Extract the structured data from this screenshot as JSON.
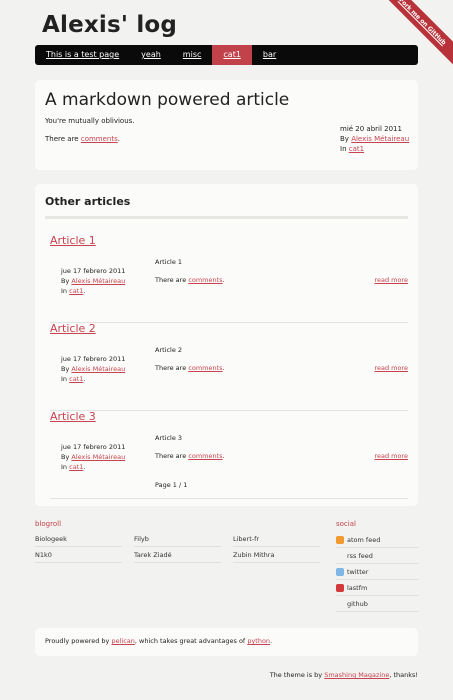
{
  "ribbon": {
    "label": "Fork me on GitHub"
  },
  "site": {
    "title": "Alexis' log"
  },
  "nav": [
    {
      "label": "This is a test page",
      "active": false
    },
    {
      "label": "yeah",
      "active": false
    },
    {
      "label": "misc",
      "active": false
    },
    {
      "label": "cat1",
      "active": true
    },
    {
      "label": "bar",
      "active": false
    }
  ],
  "featured": {
    "title": "A markdown powered article",
    "summary": "You're mutually oblivious.",
    "comments_prefix": "There are",
    "comments_link": "comments",
    "comments_suffix": ".",
    "date": "mié 20 abril 2011",
    "by": "By",
    "author": "Alexis Métaireau",
    "in": "In",
    "category": "cat1"
  },
  "others": {
    "heading": "Other articles",
    "articles": [
      {
        "title": "Article 1",
        "date": "jue 17 febrero 2011",
        "by": "By",
        "author": "Alexis Métaireau",
        "in": "In",
        "category": "cat1",
        "body": "Article 1",
        "comments_prefix": "There are",
        "comments_link": "comments",
        "comments_suffix": ".",
        "read_more": "read more"
      },
      {
        "title": "Article 2",
        "date": "jue 17 febrero 2011",
        "by": "By",
        "author": "Alexis Métaireau",
        "in": "In",
        "category": "cat1",
        "body": "Article 2",
        "comments_prefix": "There are",
        "comments_link": "comments",
        "comments_suffix": ".",
        "read_more": "read more"
      },
      {
        "title": "Article 3",
        "date": "jue 17 febrero 2011",
        "by": "By",
        "author": "Alexis Métaireau",
        "in": "In",
        "category": "cat1",
        "body": "Article 3",
        "comments_prefix": "There are",
        "comments_link": "comments",
        "comments_suffix": ".",
        "read_more": "read more"
      }
    ],
    "pager": "Page 1 / 1"
  },
  "blogroll": {
    "title": "blogroll",
    "links": [
      "Biologeek",
      "Filyb",
      "Libert-fr",
      "N1k0",
      "Tarek Ziadé",
      "Zubin Mithra"
    ]
  },
  "social": {
    "title": "social",
    "links": [
      {
        "label": "atom feed",
        "icon": "rss-icon",
        "color": "#f29a2e"
      },
      {
        "label": "rss feed",
        "icon": "",
        "color": ""
      },
      {
        "label": "twitter",
        "icon": "twitter-icon",
        "color": "#7fb6e6"
      },
      {
        "label": "lastfm",
        "icon": "lastfm-icon",
        "color": "#d33a3a"
      },
      {
        "label": "github",
        "icon": "",
        "color": ""
      }
    ]
  },
  "footer": {
    "prefix": "Proudly powered by",
    "pelican": "pelican",
    "middle": ", which takes great advantages of",
    "python": "python",
    "suffix": "."
  },
  "credit": {
    "prefix": "The theme is by",
    "link": "Smashing Magazine",
    "suffix": ", thanks!"
  }
}
